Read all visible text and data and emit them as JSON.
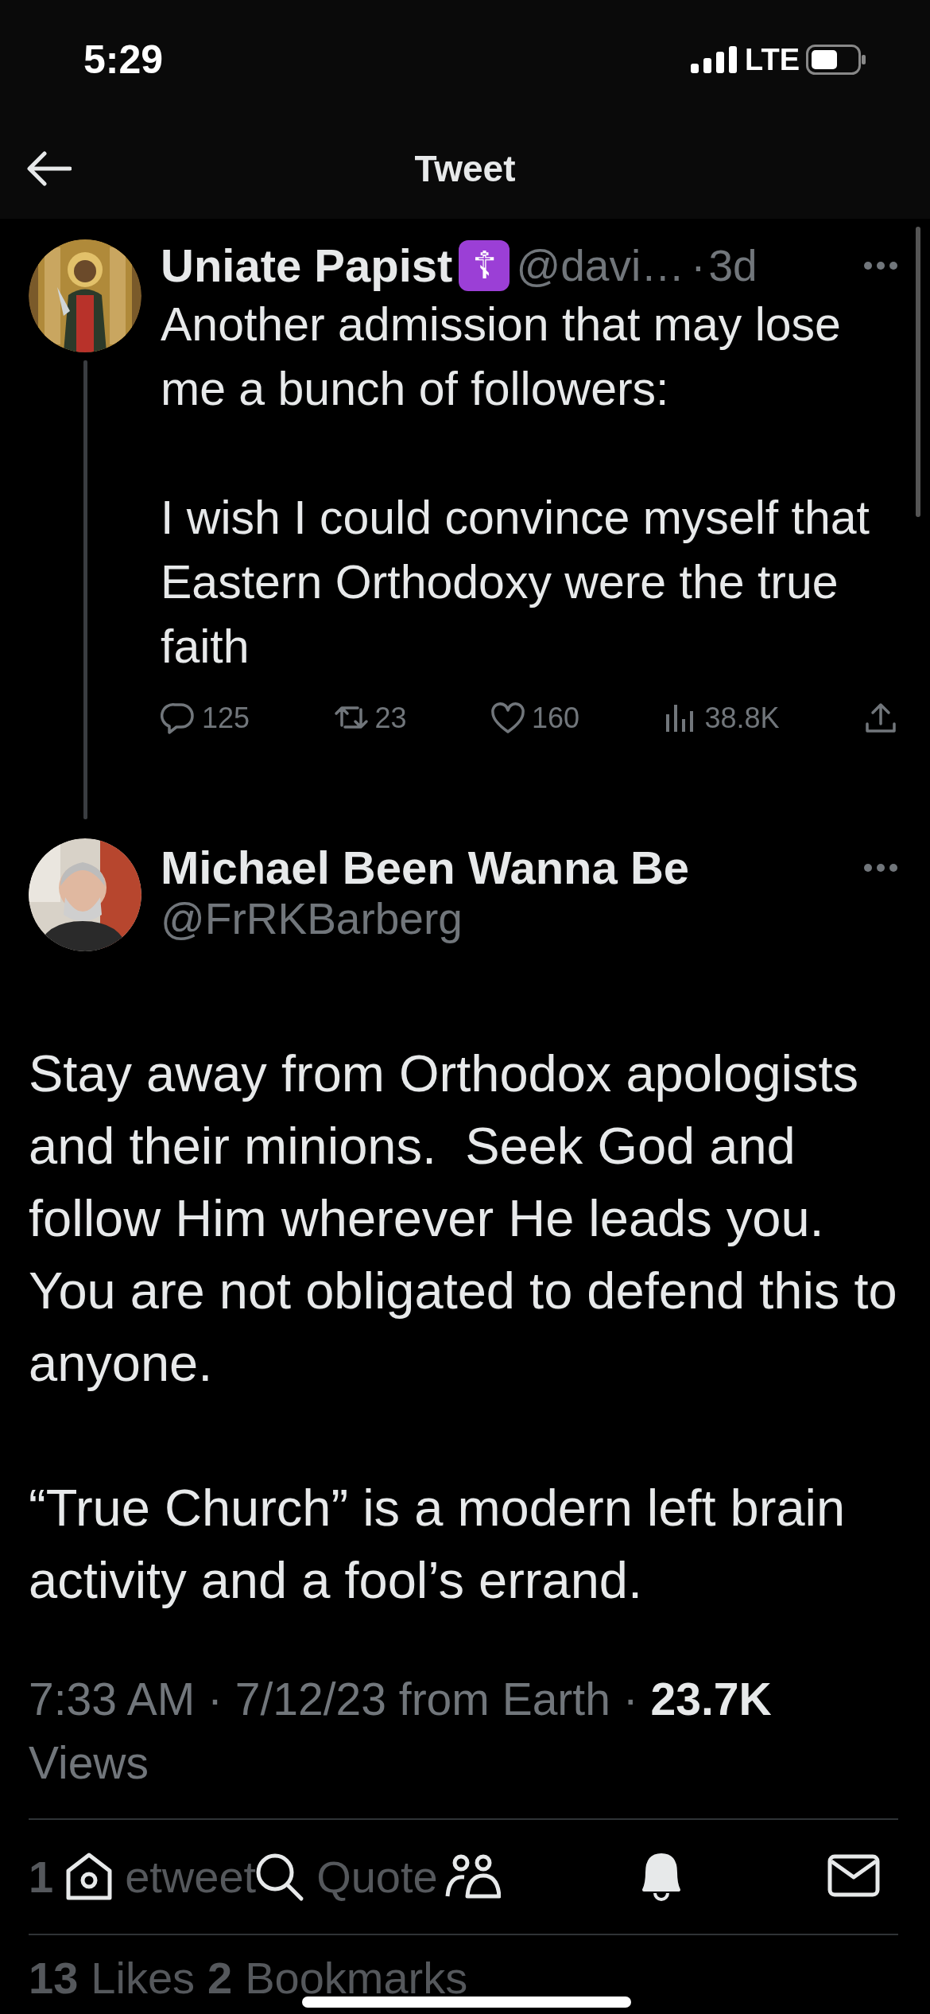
{
  "status_bar": {
    "time": "5:29",
    "network": "LTE"
  },
  "header": {
    "title": "Tweet"
  },
  "parent_tweet": {
    "name": "Uniate Papist",
    "badge": "☦",
    "handle": "@davi…",
    "separator": "·",
    "time": "3d",
    "paragraphs": [
      "Another admission that may lose me a bunch of followers:",
      "I wish I could convince myself that Eastern Orthodoxy were the true faith"
    ],
    "actions": [
      {
        "kind": "reply",
        "count": "125"
      },
      {
        "kind": "retweet",
        "count": "23"
      },
      {
        "kind": "like",
        "count": "160"
      },
      {
        "kind": "views",
        "count": "38.8K"
      },
      {
        "kind": "share"
      }
    ]
  },
  "tweet": {
    "name": "Michael Been Wanna Be",
    "handle": "@FrRKBarberg",
    "paragraphs": [
      "Stay away from Orthodox apologists and their minions.  Seek God and follow Him wherever He leads you.  You are not obligated to defend this to anyone.",
      "“True Church” is a modern left brain activity and a fool’s errand."
    ],
    "meta": "7:33 AM · 7/12/23 from Earth · **23.7K** Views"
  },
  "engagement": [
    [
      {
        "kind": "count",
        "text": "1"
      },
      {
        "kind": "label",
        "text": "etweet"
      },
      {
        "kind": "label",
        "text": "Quote"
      }
    ],
    [
      {
        "kind": "count",
        "text": "13"
      },
      {
        "kind": "label",
        "text": "Likes"
      },
      {
        "kind": "count",
        "text": "2"
      },
      {
        "kind": "label",
        "text": "Bookmarks"
      }
    ]
  ],
  "tab_bar": [
    {
      "kind": "home"
    },
    {
      "kind": "search"
    },
    {
      "kind": "communities"
    },
    {
      "kind": "notifications"
    },
    {
      "kind": "messages"
    }
  ]
}
